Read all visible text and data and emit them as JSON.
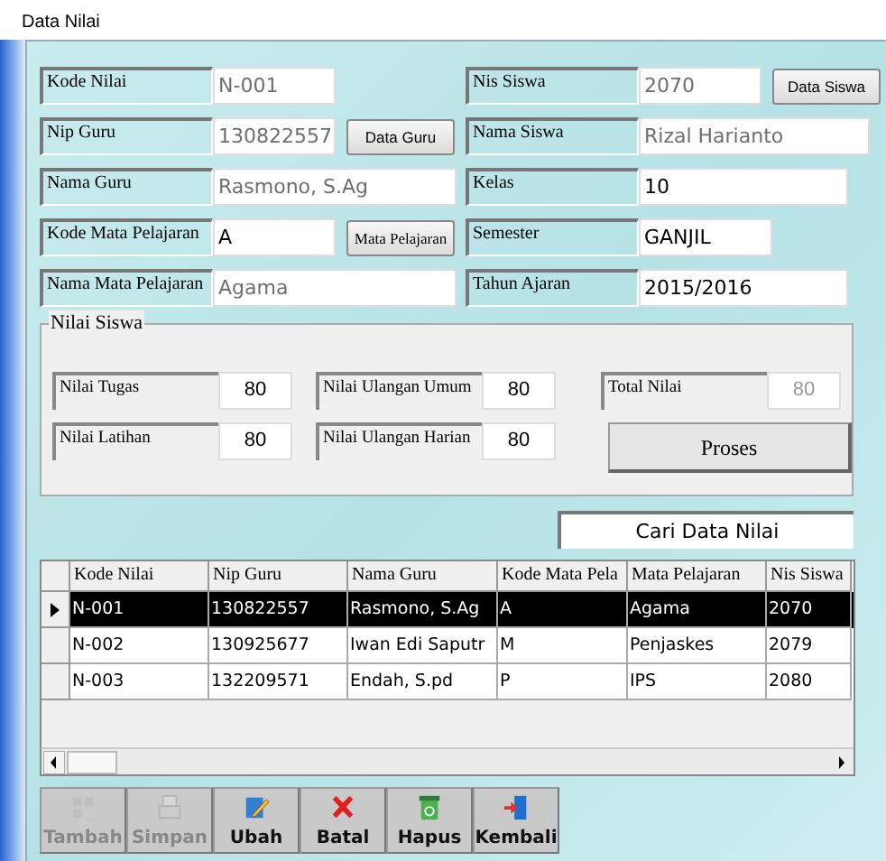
{
  "window": {
    "title": "Data Nilai"
  },
  "form_rows": [
    {
      "left": {
        "label": "Kode Nilai",
        "value": "N-001",
        "disabled": true
      },
      "right": {
        "label": "Nis Siswa",
        "value": "2070",
        "disabled": true,
        "button": "Data Siswa"
      }
    },
    {
      "left": {
        "label": "Nip Guru",
        "value": "130822557",
        "disabled": true,
        "button": "Data Guru"
      },
      "right": {
        "label": "Nama Siswa",
        "value": "Rizal Harianto",
        "disabled": true
      }
    },
    {
      "left": {
        "label": "Nama Guru",
        "value": "Rasmono, S.Ag",
        "disabled": true
      },
      "right": {
        "label": "Kelas",
        "value": "10",
        "disabled": false
      }
    },
    {
      "left": {
        "label": "Kode Mata Pelajaran",
        "value": "A",
        "disabled": false,
        "button": "Mata Pelajaran"
      },
      "right": {
        "label": "Semester",
        "value": "GANJIL",
        "disabled": false
      }
    },
    {
      "left": {
        "label": "Nama Mata Pelajaran",
        "value": "Agama",
        "disabled": true
      },
      "right": {
        "label": "Tahun Ajaran",
        "value": "2015/2016",
        "disabled": false
      }
    }
  ],
  "nilai_siswa": {
    "title": "Nilai Siswa",
    "fields": [
      {
        "label": "Nilai Tugas",
        "value": "80",
        "disabled": false
      },
      {
        "label": "Nilai Ulangan Umum",
        "value": "80",
        "disabled": false
      },
      {
        "label": "Total Nilai",
        "value": "80",
        "disabled": true
      },
      {
        "label": "Nilai Latihan",
        "value": "80",
        "disabled": false
      },
      {
        "label": "Nilai Ulangan Harian",
        "value": "80",
        "disabled": false
      }
    ],
    "button": "Proses"
  },
  "search": {
    "placeholder": "Cari Data Nilai"
  },
  "table": {
    "columns": [
      "Kode Nilai",
      "Nip Guru",
      "Nama Guru",
      "Kode Mata Pela",
      "Mata Pelajaran",
      "Nis Siswa"
    ],
    "rows": [
      {
        "selected": true,
        "cells": [
          "N-001",
          "130822557",
          "Rasmono, S.Ag",
          "A",
          "Agama",
          "2070"
        ]
      },
      {
        "selected": false,
        "cells": [
          "N-002",
          "130925677",
          "Iwan Edi Saputr",
          "M",
          "Penjaskes",
          "2079"
        ]
      },
      {
        "selected": false,
        "cells": [
          "N-003",
          "132209571",
          "Endah, S.pd",
          "P",
          "IPS",
          "2080"
        ]
      }
    ]
  },
  "toolbar": [
    {
      "kind": "add",
      "label": "Tambah",
      "disabled": true
    },
    {
      "kind": "save",
      "label": "Simpan",
      "disabled": true
    },
    {
      "kind": "edit",
      "label": "Ubah",
      "disabled": false
    },
    {
      "kind": "cancel",
      "label": "Batal",
      "disabled": false
    },
    {
      "kind": "delete",
      "label": "Hapus",
      "disabled": false
    },
    {
      "kind": "exit",
      "label": "Kembali",
      "disabled": false
    }
  ]
}
